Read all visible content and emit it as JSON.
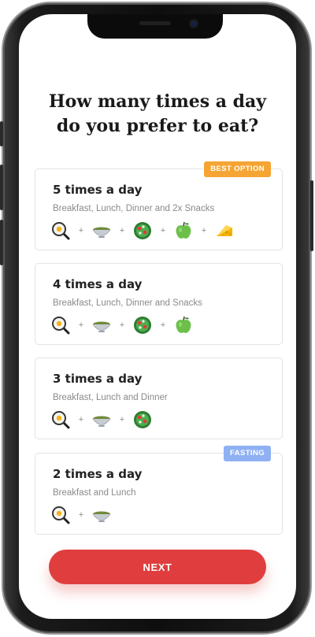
{
  "question": {
    "line1": "How many times a day",
    "line2": "do you prefer to eat?"
  },
  "options": [
    {
      "title": "5 times a day",
      "subtitle": "Breakfast, Lunch, Dinner and 2x Snacks",
      "badge": "BEST OPTION",
      "foods": [
        "frying-pan-egg-icon",
        "soup-bowl-icon",
        "salad-bowl-icon",
        "green-apple-icon",
        "cheese-icon"
      ]
    },
    {
      "title": "4 times a day",
      "subtitle": "Breakfast, Lunch, Dinner and Snacks",
      "foods": [
        "frying-pan-egg-icon",
        "soup-bowl-icon",
        "salad-bowl-icon",
        "green-apple-icon"
      ]
    },
    {
      "title": "3 times a day",
      "subtitle": "Breakfast, Lunch and Dinner",
      "foods": [
        "frying-pan-egg-icon",
        "soup-bowl-icon",
        "salad-bowl-icon"
      ]
    },
    {
      "title": "2 times a day",
      "subtitle": "Breakfast and Lunch",
      "badge": "FASTING",
      "foods": [
        "frying-pan-egg-icon",
        "soup-bowl-icon"
      ]
    }
  ],
  "plus_sign": "+",
  "next_label": "NEXT",
  "colors": {
    "accent_button": "#e03e3e",
    "badge_best": "#f5a533",
    "badge_fasting": "#8fb1f3"
  }
}
